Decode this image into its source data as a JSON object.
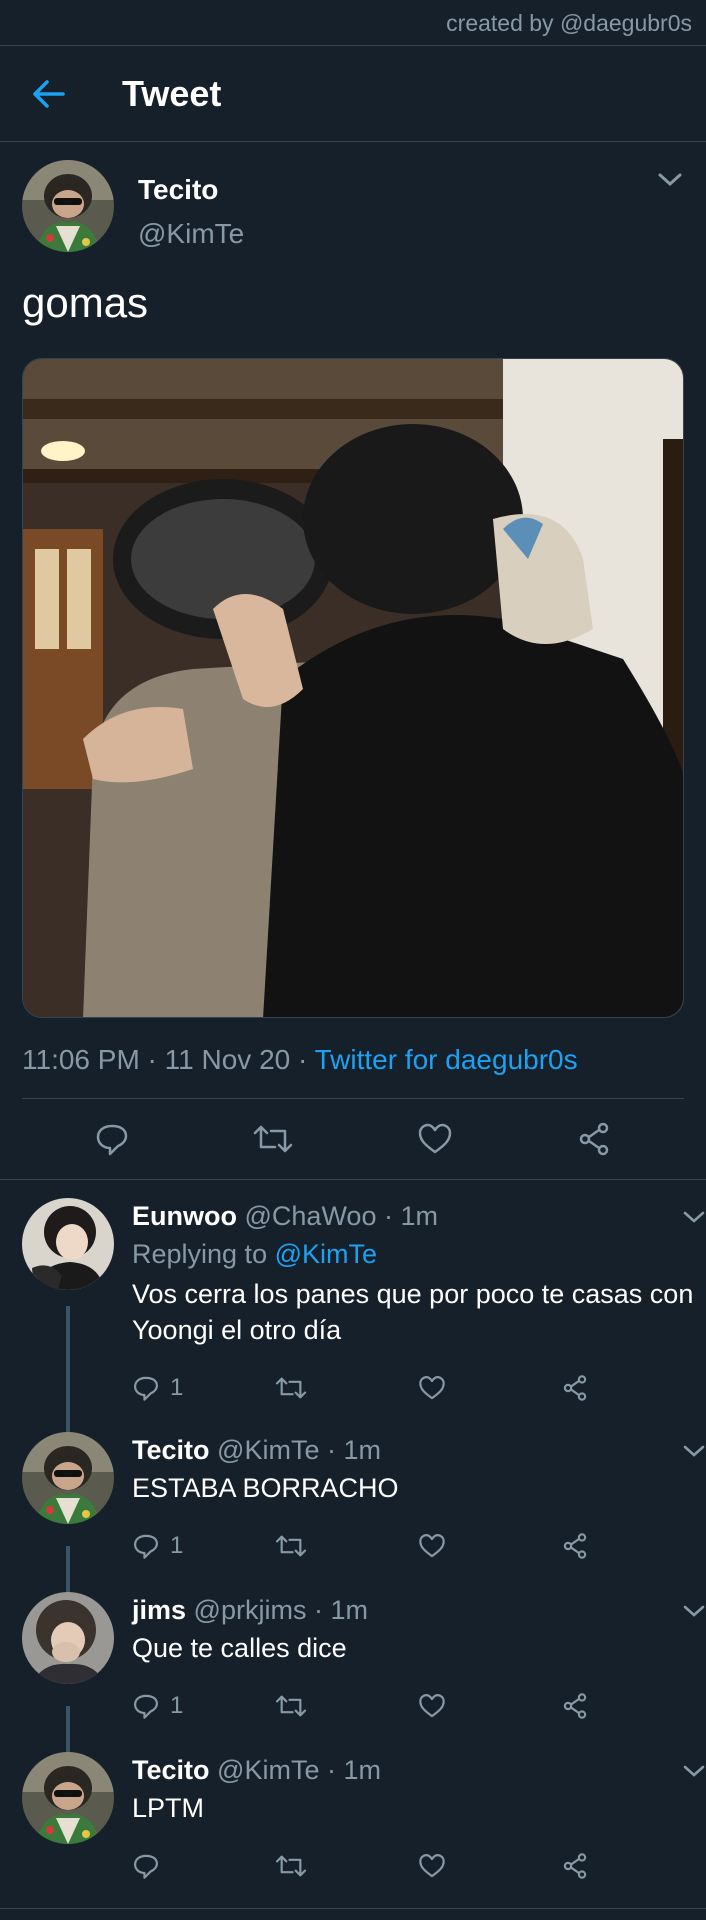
{
  "credit": "created by @daegubr0s",
  "header": {
    "title": "Tweet"
  },
  "main_tweet": {
    "name": "Tecito",
    "handle": "@KimTe",
    "text": "gomas",
    "time": "11:06 PM · 11 Nov 20 · ",
    "source": "Twitter for daegubr0s"
  },
  "replies": [
    {
      "name": "Eunwoo",
      "handle": "@ChaWoo",
      "time": "· 1m",
      "replying_prefix": "Replying to ",
      "replying_to": "@KimTe",
      "text": "Vos cerra los panes que por poco te casas con Yoongi el otro día",
      "reply_count": "1"
    },
    {
      "name": "Tecito",
      "handle": "@KimTe",
      "time": "· 1m",
      "text": "ESTABA BORRACHO",
      "reply_count": "1"
    },
    {
      "name": "jims",
      "handle": "@prkjims",
      "time": "· 1m",
      "text": "Que te calles dice",
      "reply_count": "1"
    },
    {
      "name": "Tecito",
      "handle": "@KimTe",
      "time": "· 1m",
      "text": "LPTM",
      "reply_count": ""
    }
  ],
  "colors": {
    "background": "#15202b",
    "accent": "#1da1f2",
    "muted": "#8899a6",
    "border": "#38444d"
  }
}
